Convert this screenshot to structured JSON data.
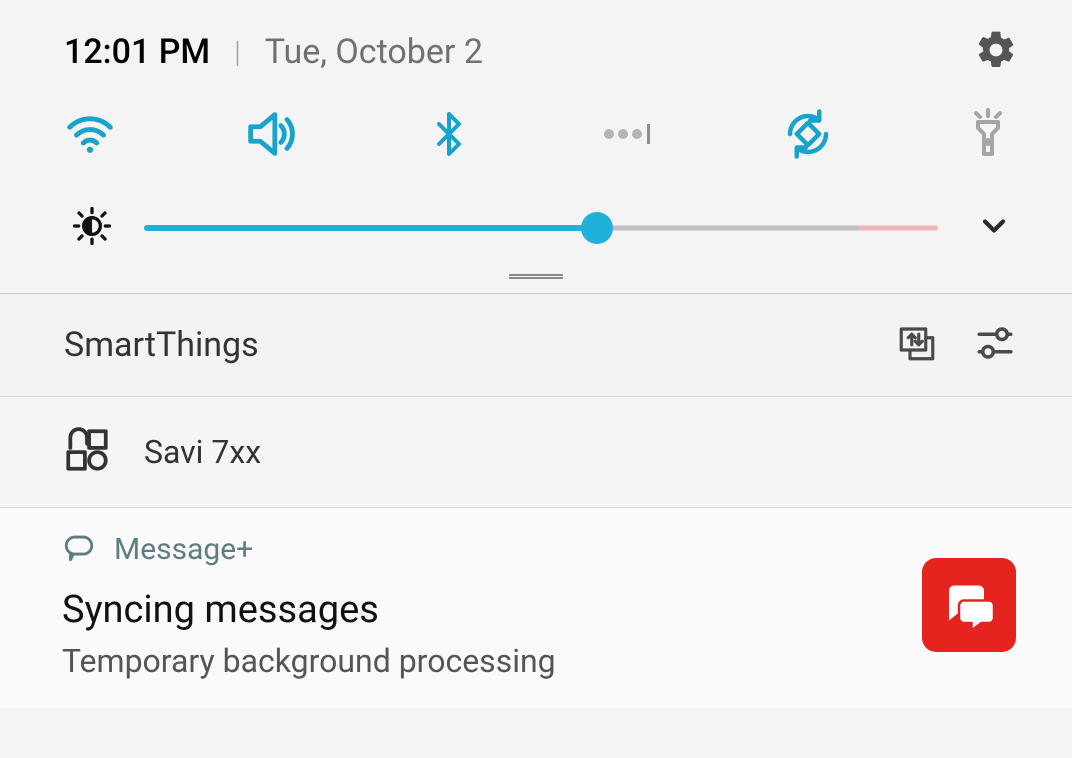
{
  "colors": {
    "accent": "#18a3cd",
    "badge": "#e6231f"
  },
  "statusbar": {
    "time": "12:01 PM",
    "date": "Tue, October 2"
  },
  "quick_toggles": [
    {
      "id": "wifi",
      "label": "Wi-Fi",
      "icon": "wifi",
      "active": true
    },
    {
      "id": "sound",
      "label": "Sound",
      "icon": "volume",
      "active": true
    },
    {
      "id": "bluetooth",
      "label": "Bluetooth",
      "icon": "bluetooth",
      "active": true
    },
    {
      "id": "do-not-disturb",
      "label": "Quick actions",
      "icon": "dots",
      "active": false
    },
    {
      "id": "auto-rotate",
      "label": "Auto rotate",
      "icon": "rotate",
      "active": true
    },
    {
      "id": "flashlight",
      "label": "Flashlight",
      "icon": "flashlight",
      "active": false
    }
  ],
  "brightness": {
    "percent": 57,
    "warn_percent": 10
  },
  "smartthings": {
    "title": "SmartThings",
    "actions": [
      "transfer",
      "device-controls"
    ],
    "devices": [
      {
        "icon": "media-grid",
        "name": "Savi 7xx"
      }
    ]
  },
  "notifications": [
    {
      "app": "Message+",
      "app_icon": "chat-bubble",
      "title": "Syncing messages",
      "body": "Temporary background processing",
      "badge_icon": "chat-pair"
    }
  ]
}
